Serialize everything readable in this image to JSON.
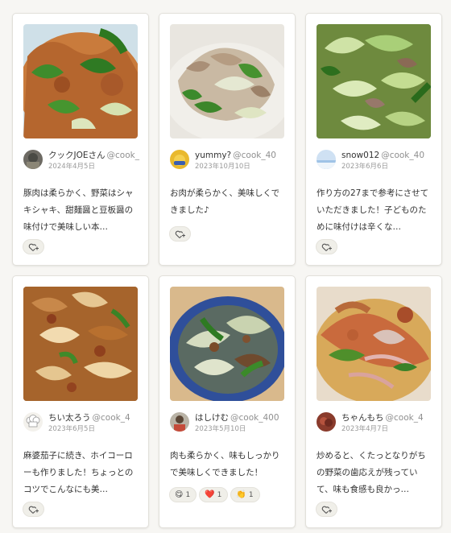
{
  "cards": [
    {
      "user_name": "クックJOEさん",
      "user_id": "@cook_",
      "date": "2024年4月5日",
      "comment": "豚肉は柔らかく、野菜はシャキシャキ、甜麺醤と豆板醤の味付けで美味しい本…",
      "photo_icon": "stir-fry-photo",
      "avatar_icon": "user-avatar"
    },
    {
      "user_name": "yummy?",
      "user_id": "@cook_40",
      "date": "2023年10月10日",
      "comment": "お肉が柔らかく、美味しくできました♪",
      "photo_icon": "stir-fry-photo",
      "avatar_icon": "user-avatar"
    },
    {
      "user_name": "snow012",
      "user_id": "@cook_40",
      "date": "2023年6月6日",
      "comment": "作り方の27まで参考にさせていただきました！子どものために味付けは辛くな…",
      "photo_icon": "stir-fry-photo",
      "avatar_icon": "user-avatar"
    },
    {
      "user_name": "ちい太ろう",
      "user_id": "@cook_4",
      "date": "2023年6月5日",
      "comment": "麻婆茄子に続き、ホイコーローも作りました！ちょっとのコツでこんなにも美…",
      "photo_icon": "stir-fry-photo",
      "avatar_icon": "chef-hat-avatar"
    },
    {
      "user_name": "はしけむ",
      "user_id": "@cook_400",
      "date": "2023年5月10日",
      "comment": "肉も柔らかく、味もしっかりで美味しくできました！",
      "photo_icon": "stir-fry-photo",
      "avatar_icon": "user-avatar",
      "reactions": [
        {
          "emoji": "😋",
          "count": "1"
        },
        {
          "emoji": "❤️",
          "count": "1"
        },
        {
          "emoji": "👏",
          "count": "1"
        }
      ]
    },
    {
      "user_name": "ちゃんもち",
      "user_id": "@cook_4",
      "date": "2023年4月7日",
      "comment": "炒めると、くたっとなりがちの野菜の歯応えが残っていて、味も食感も良かっ…",
      "photo_icon": "stir-fry-photo",
      "avatar_icon": "user-avatar"
    }
  ],
  "add_reaction_icon": "heart-plus-icon",
  "colors": {
    "background": "#f7f6f3",
    "card_border": "#e2e0da",
    "muted_text": "#9a9a9a"
  }
}
